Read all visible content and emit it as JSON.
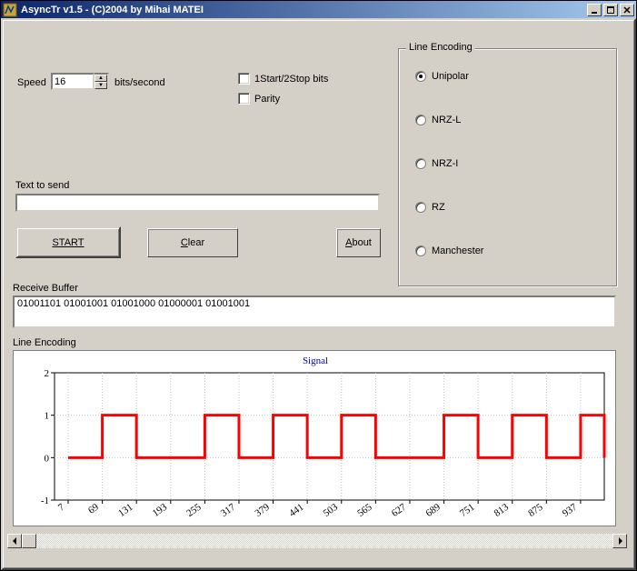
{
  "window": {
    "title": "AsyncTr v1.5 - (C)2004 by Mihai MATEI"
  },
  "speed": {
    "label": "Speed",
    "value": "16",
    "unit": "bits/second"
  },
  "options": {
    "startstop_label": "1Start/2Stop bits",
    "startstop_checked": false,
    "parity_label": "Parity",
    "parity_checked": false
  },
  "encoding_group": {
    "title": "Line Encoding",
    "items": [
      {
        "label": "Unipolar",
        "checked": true
      },
      {
        "label": "NRZ-L",
        "checked": false
      },
      {
        "label": "NRZ-I",
        "checked": false
      },
      {
        "label": "RZ",
        "checked": false
      },
      {
        "label": "Manchester",
        "checked": false
      }
    ]
  },
  "text_to_send": {
    "label": "Text to send",
    "value": ""
  },
  "buttons": {
    "start": "START",
    "clear": "Clear",
    "about": "About"
  },
  "receive_buffer": {
    "label": "Receive Buffer",
    "value": "01001101 01001001 01001000 01000001 01001001"
  },
  "chart_section_label": "Line Encoding",
  "chart_data": {
    "type": "line",
    "title": "Signal",
    "xlabel": "",
    "ylabel": "",
    "ylim": [
      -1,
      2
    ],
    "yticks": [
      -1,
      0,
      1,
      2
    ],
    "xticks": [
      7,
      69,
      131,
      193,
      255,
      317,
      379,
      441,
      503,
      565,
      627,
      689,
      751,
      813,
      875,
      937
    ],
    "x": [
      7,
      69,
      69,
      131,
      131,
      193,
      193,
      255,
      255,
      317,
      317,
      379,
      379,
      441,
      441,
      503,
      503,
      565,
      565,
      627,
      627,
      689,
      689,
      751,
      751,
      813,
      813,
      875,
      875,
      937,
      937,
      980,
      980
    ],
    "y": [
      0,
      0,
      1,
      1,
      0,
      0,
      0,
      0,
      1,
      1,
      0,
      0,
      1,
      1,
      0,
      0,
      1,
      1,
      0,
      0,
      0,
      0,
      1,
      1,
      0,
      0,
      1,
      1,
      0,
      0,
      1,
      1,
      0
    ],
    "color": "#ff0000"
  }
}
